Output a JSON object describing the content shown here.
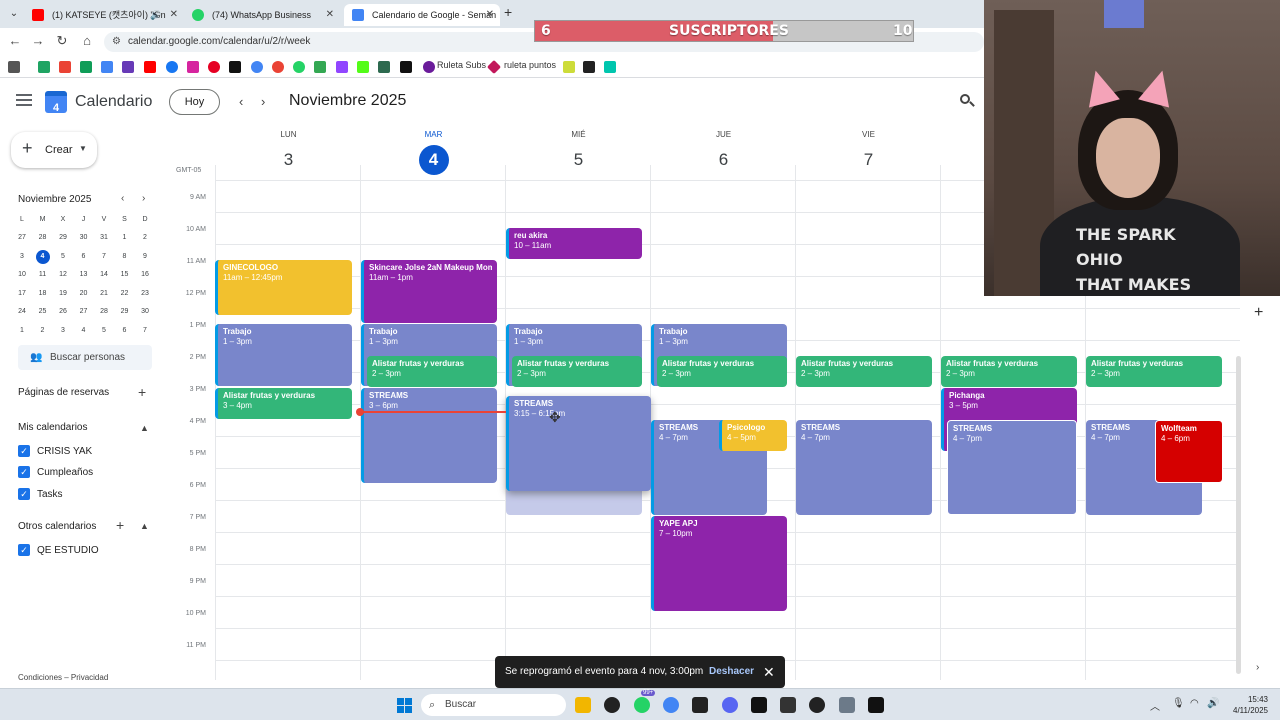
{
  "browser": {
    "tabs": [
      {
        "title": "(1) KATSEYE (캣츠아이) \"Gn",
        "favicon_color": "#ff0000",
        "has_audio": true
      },
      {
        "title": "(74) WhatsApp Business",
        "favicon_color": "#25d366"
      },
      {
        "title": "Calendario de Google - Seman",
        "favicon_color": "#4285f4",
        "active": true
      }
    ],
    "url": "calendar.google.com/calendar/u/2/r/week",
    "bookmarks": [
      {
        "label": "Ruleta Subs"
      },
      {
        "label": "ruleta puntos"
      }
    ]
  },
  "overlay": {
    "subs_left": "6",
    "subs_label": "SUSCRIPTORES",
    "subs_right": "10",
    "subs_progress": 0.63,
    "shirt_text": "THE SPARK\nOHIO\nTHAT MAKES"
  },
  "header": {
    "app_title": "Calendario",
    "logo_day": "4",
    "today_button": "Hoy",
    "month_title": "Noviembre 2025"
  },
  "sidebar": {
    "create_label": "Crear",
    "mini_month": "Noviembre 2025",
    "weekday_heads": [
      "L",
      "M",
      "X",
      "J",
      "V",
      "S",
      "D"
    ],
    "mini_days": [
      [
        "27",
        "28",
        "29",
        "30",
        "31",
        "1",
        "2"
      ],
      [
        "3",
        "4",
        "5",
        "6",
        "7",
        "8",
        "9"
      ],
      [
        "10",
        "11",
        "12",
        "13",
        "14",
        "15",
        "16"
      ],
      [
        "17",
        "18",
        "19",
        "20",
        "21",
        "22",
        "23"
      ],
      [
        "24",
        "25",
        "26",
        "27",
        "28",
        "29",
        "30"
      ],
      [
        "1",
        "2",
        "3",
        "4",
        "5",
        "6",
        "7"
      ]
    ],
    "search_people": "Buscar personas",
    "booking_pages": "Páginas de reservas",
    "my_calendars": "Mis calendarios",
    "my_calendar_items": [
      "CRISIS YAK",
      "Cumpleaños",
      "Tasks"
    ],
    "other_calendars": "Otros calendarios",
    "other_calendar_items": [
      "QE ESTUDIO"
    ],
    "footer": "Condiciones – Privacidad"
  },
  "week": {
    "timezone": "GMT-05",
    "days": [
      {
        "name": "LUN",
        "num": "3"
      },
      {
        "name": "MAR",
        "num": "4",
        "today": true
      },
      {
        "name": "MIÉ",
        "num": "5"
      },
      {
        "name": "JUE",
        "num": "6"
      },
      {
        "name": "VIE",
        "num": "7"
      }
    ],
    "hours": [
      "9 AM",
      "10 AM",
      "11 AM",
      "12 PM",
      "1 PM",
      "2 PM",
      "3 PM",
      "4 PM",
      "5 PM",
      "6 PM",
      "7 PM",
      "8 PM",
      "9 PM",
      "10 PM",
      "11 PM"
    ]
  },
  "events": [
    {
      "title": "GINECOLOGO",
      "time": "11am – 12:45pm",
      "color": "yellow"
    },
    {
      "title": "Skincare Jolse 2aN Makeup Momo",
      "time": "11am – 1pm",
      "color": "purple"
    },
    {
      "title": "reu akira",
      "time": "10 – 11am",
      "color": "purple"
    },
    {
      "title": "Trabajo",
      "time": "1 – 3pm",
      "color": "lav"
    },
    {
      "title": "Trabajo",
      "time": "1 – 3pm",
      "color": "lav"
    },
    {
      "title": "Trabajo",
      "time": "1 – 3pm",
      "color": "lav"
    },
    {
      "title": "Trabajo",
      "time": "1 – 3pm",
      "color": "lav"
    },
    {
      "title": "Alistar frutas y verduras",
      "time": "3 – 4pm",
      "color": "green"
    },
    {
      "title": "Alistar frutas y verduras",
      "time": "2 – 3pm",
      "color": "green"
    },
    {
      "title": "Alistar frutas y verduras",
      "time": "2 – 3pm",
      "color": "green"
    },
    {
      "title": "Alistar frutas y verduras",
      "time": "2 – 3pm",
      "color": "green"
    },
    {
      "title": "Alistar frutas y verduras",
      "time": "2 – 3pm",
      "color": "green"
    },
    {
      "title": "Alistar frutas y verduras",
      "time": "2 – 3pm",
      "color": "green"
    },
    {
      "title": "Alistar frutas y verduras",
      "time": "2 – 3pm",
      "color": "green"
    },
    {
      "title": "STREAMS",
      "time": "3 – 6pm",
      "color": "lav"
    },
    {
      "title": "STREAMS",
      "time": "3:15 – 6:15pm",
      "color": "lav"
    },
    {
      "title": "STREAMS",
      "time": "4 – 7pm",
      "color": "lav"
    },
    {
      "title": "Psicologo",
      "time": "4 – 5pm",
      "color": "yellow"
    },
    {
      "title": "STREAMS",
      "time": "4 – 7pm",
      "color": "lav"
    },
    {
      "title": "Pichanga",
      "time": "3 – 5pm",
      "color": "purple"
    },
    {
      "title": "STREAMS",
      "time": "4 – 7pm",
      "color": "lav"
    },
    {
      "title": "STREAMS",
      "time": "4 – 7pm",
      "color": "lav"
    },
    {
      "title": "Wolfteam",
      "time": "4 – 6pm",
      "color": "red"
    },
    {
      "title": "YAPE APJ",
      "time": "7 – 10pm",
      "color": "purple"
    }
  ],
  "toast": {
    "message": "Se reprogramó el evento para 4 nov, 3:00pm",
    "undo": "Deshacer"
  },
  "taskbar": {
    "search": "Buscar",
    "time": "15:43",
    "date": "4/11/2025",
    "badge": "99+"
  }
}
